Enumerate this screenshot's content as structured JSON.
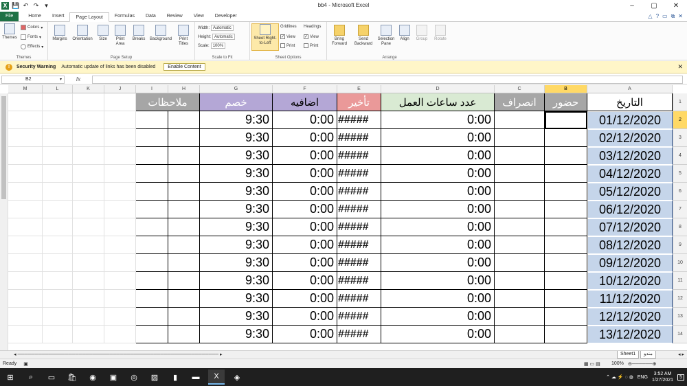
{
  "window": {
    "title": "bb4 - Microsoft Excel",
    "min": "–",
    "max": "▢",
    "close": "✕"
  },
  "tabs": [
    "File",
    "Home",
    "Insert",
    "Page Layout",
    "Formulas",
    "Data",
    "Review",
    "View",
    "Developer"
  ],
  "active_tab": "Page Layout",
  "ribbon": {
    "themes": {
      "themes_label": "Themes",
      "colors": "Colors",
      "fonts": "Fonts",
      "effects": "Effects",
      "group": "Themes"
    },
    "page_setup": {
      "margins": "Margins",
      "orientation": "Orientation",
      "size": "Size",
      "print_area": "Print Area",
      "breaks": "Breaks",
      "background": "Background",
      "print_titles": "Print Titles",
      "group": "Page Setup"
    },
    "scale": {
      "width_label": "Width:",
      "width_val": "Automatic",
      "height_label": "Height:",
      "height_val": "Automatic",
      "scale_label": "Scale:",
      "scale_val": "100%",
      "group": "Scale to Fit"
    },
    "sheet_options": {
      "sheet_rtl": "Sheet Right-to-Left",
      "gridlines": "Gridlines",
      "headings": "Headings",
      "view": "View",
      "print": "Print",
      "group": "Sheet Options"
    },
    "arrange": {
      "bring_forward": "Bring Forward",
      "send_backward": "Send Backward",
      "selection_pane": "Selection Pane",
      "align": "Align",
      "group_btn": "Group",
      "rotate": "Rotate",
      "group": "Arrange"
    }
  },
  "security": {
    "title": "Security Warning",
    "message": "Automatic update of links has been disabled",
    "button": "Enable Content"
  },
  "formula_bar": {
    "name_box": "B2",
    "fx": "fx",
    "value": ""
  },
  "columns": [
    "M",
    "L",
    "K",
    "J",
    "I",
    "H",
    "G",
    "F",
    "E",
    "D",
    "C",
    "B",
    "A"
  ],
  "headers": {
    "date": "التاريخ",
    "attend": "حضور",
    "leave": "انصراف",
    "hours": "عدد ساعات العمل",
    "late": "تأخير",
    "extra": "اضافيه",
    "deduct": "خصم",
    "notes": "ملاحظات"
  },
  "rows": [
    {
      "n": "1"
    },
    {
      "n": "2",
      "date": "01/12/2020",
      "hours": "0:00",
      "late": "#####",
      "extra": "0:00",
      "deduct": "9:30"
    },
    {
      "n": "3",
      "date": "02/12/2020",
      "hours": "0:00",
      "late": "#####",
      "extra": "0:00",
      "deduct": "9:30"
    },
    {
      "n": "4",
      "date": "03/12/2020",
      "hours": "0:00",
      "late": "#####",
      "extra": "0:00",
      "deduct": "9:30"
    },
    {
      "n": "5",
      "date": "04/12/2020",
      "hours": "0:00",
      "late": "#####",
      "extra": "0:00",
      "deduct": "9:30"
    },
    {
      "n": "6",
      "date": "05/12/2020",
      "hours": "0:00",
      "late": "#####",
      "extra": "0:00",
      "deduct": "9:30"
    },
    {
      "n": "7",
      "date": "06/12/2020",
      "hours": "0:00",
      "late": "#####",
      "extra": "0:00",
      "deduct": "9:30"
    },
    {
      "n": "8",
      "date": "07/12/2020",
      "hours": "0:00",
      "late": "#####",
      "extra": "0:00",
      "deduct": "9:30"
    },
    {
      "n": "9",
      "date": "08/12/2020",
      "hours": "0:00",
      "late": "#####",
      "extra": "0:00",
      "deduct": "9:30"
    },
    {
      "n": "10",
      "date": "09/12/2020",
      "hours": "0:00",
      "late": "#####",
      "extra": "0:00",
      "deduct": "9:30"
    },
    {
      "n": "11",
      "date": "10/12/2020",
      "hours": "0:00",
      "late": "#####",
      "extra": "0:00",
      "deduct": "9:30"
    },
    {
      "n": "12",
      "date": "11/12/2020",
      "hours": "0:00",
      "late": "#####",
      "extra": "0:00",
      "deduct": "9:30"
    },
    {
      "n": "13",
      "date": "12/12/2020",
      "hours": "0:00",
      "late": "#####",
      "extra": "0:00",
      "deduct": "9:30"
    },
    {
      "n": "14",
      "date": "13/12/2020",
      "hours": "0:00",
      "late": "#####",
      "extra": "0:00",
      "deduct": "9:30"
    }
  ],
  "sheet_tabs": [
    "Sheet1",
    "مندو"
  ],
  "status": {
    "ready": "Ready",
    "zoom": "100%"
  },
  "taskbar": {
    "time": "3:52 AM",
    "date": "1/27/2021",
    "lang": "ENG",
    "notif": "5"
  },
  "colors": {
    "excel_green": "#1e7145",
    "header_purple": "#b4a7d6",
    "header_grey": "#a6a6a6",
    "header_red": "#ea9999",
    "header_green": "#d9ead3",
    "date_fill": "#c5d5ea",
    "selection": "#ffd966"
  }
}
